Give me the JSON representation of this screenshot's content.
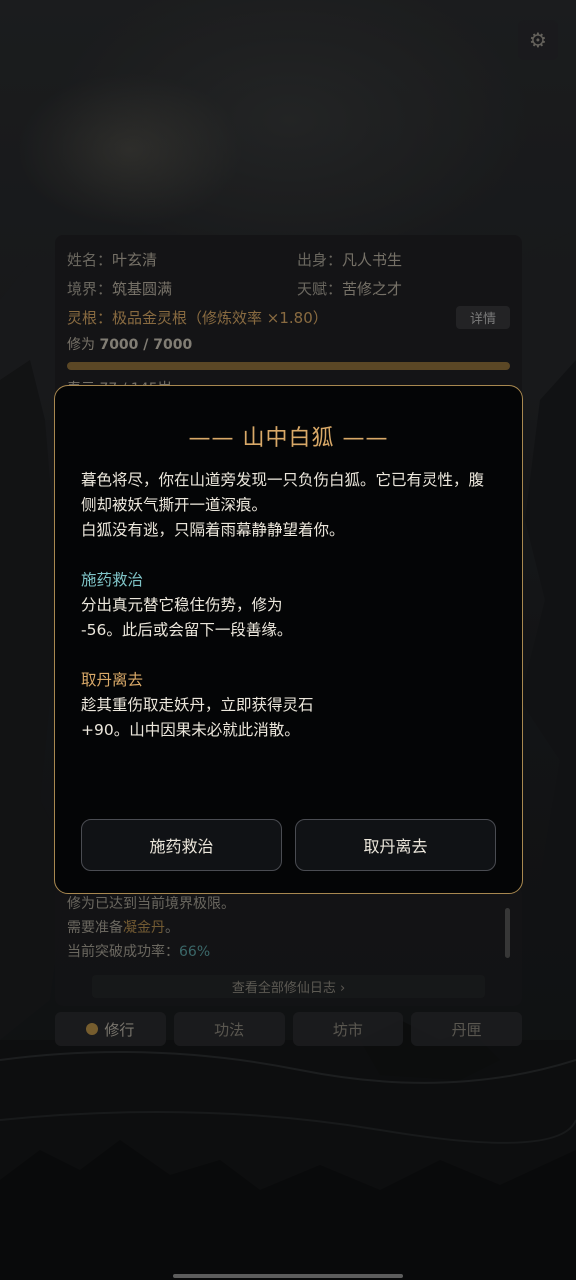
{
  "settings": {
    "icon": "gear-icon",
    "glyph": "⚙"
  },
  "character": {
    "name_label": "姓名：",
    "name": "叶玄清",
    "origin_label": "出身：",
    "origin": "凡人书生",
    "realm_label": "境界：",
    "realm": "筑基圆满",
    "talent_label": "天赋：",
    "talent": "苦修之才",
    "root_text": "灵根：极品金灵根（修炼效率 ×1.80）",
    "detail_button": "详情",
    "cultivation_label": "修为 ",
    "cultivation_value": "7000 / 7000",
    "cultivation_progress": 1.0,
    "lifespan_text": "寿元 77 / 145岁"
  },
  "log": {
    "line1": "修为已达到当前境界极限。",
    "line2_prefix": "需要准备",
    "line2_item": "凝金丹",
    "line2_suffix": "。",
    "line3_prefix": "当前突破成功率：",
    "line3_value": "66%",
    "view_all": "查看全部修仙日志 ›"
  },
  "tabs": [
    {
      "label": "修行",
      "active": true
    },
    {
      "label": "功法",
      "active": false
    },
    {
      "label": "坊市",
      "active": false
    },
    {
      "label": "丹匣",
      "active": false
    }
  ],
  "event": {
    "title": "—— 山中白狐 ——",
    "intro_1": "暮色将尽，你在山道旁发现一只负伤白狐。它已有灵性，腹侧却被妖气撕开一道深痕。",
    "intro_2": "白狐没有逃，只隔着雨幕静静望着你。",
    "option1_title": "施药救治",
    "option1_desc_1": "分出真元替它稳住伤势，修为",
    "option1_desc_2": "-56。此后或会留下一段善缘。",
    "option2_title": "取丹离去",
    "option2_desc_1": "趁其重伤取走妖丹，立即获得灵石",
    "option2_desc_2": "+90。山中因果未必就此消散。",
    "button1": "施药救治",
    "button2": "取丹离去"
  },
  "colors": {
    "accent_gold": "#d9a968",
    "accent_teal": "#7fc3c6",
    "modal_bg": "#040506",
    "modal_border": "#a88850"
  }
}
